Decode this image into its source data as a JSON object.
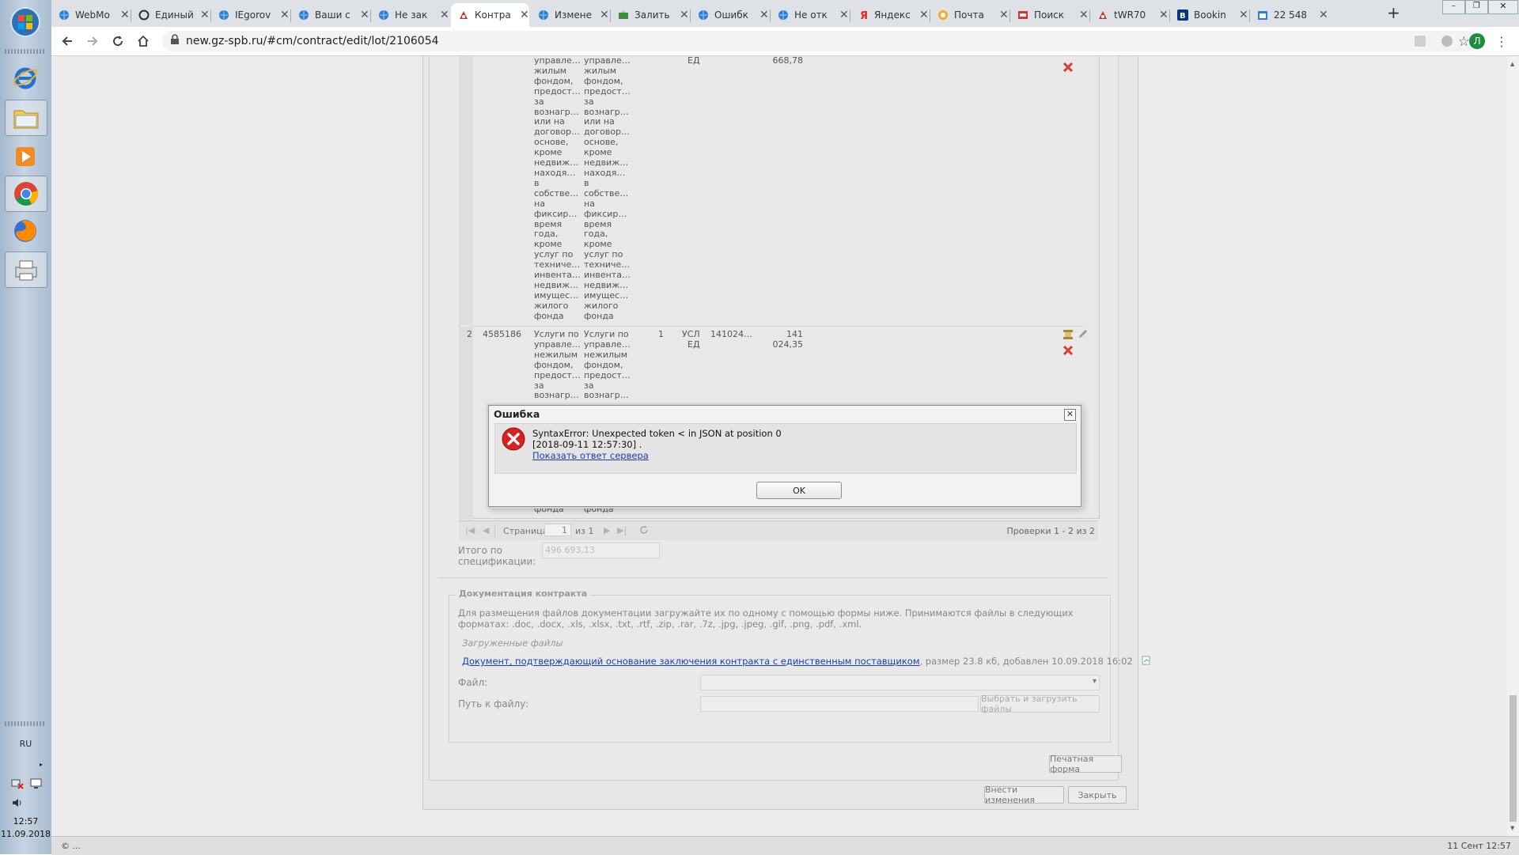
{
  "taskbar": {
    "lang": "RU",
    "time": "12:57",
    "date": "11.09.2018"
  },
  "browser": {
    "tabs": [
      {
        "label": "WebMo",
        "icon": "globe-icon",
        "active": false
      },
      {
        "label": "Единый",
        "icon": "circle-icon",
        "active": false
      },
      {
        "label": "IEgorov",
        "icon": "globe-icon",
        "active": false
      },
      {
        "label": "Ваши с",
        "icon": "globe-icon",
        "active": false
      },
      {
        "label": "Не зак",
        "icon": "globe-icon",
        "active": false
      },
      {
        "label": "Контра",
        "icon": "site-icon",
        "active": true
      },
      {
        "label": "Измене",
        "icon": "globe-icon",
        "active": false
      },
      {
        "label": "Залить",
        "icon": "upload-icon",
        "active": false
      },
      {
        "label": "Ошибк",
        "icon": "globe-icon",
        "active": false
      },
      {
        "label": "Не отк",
        "icon": "globe-icon",
        "active": false
      },
      {
        "label": "Яндекс",
        "icon": "yandex-icon",
        "active": false
      },
      {
        "label": "Почта",
        "icon": "mail-icon",
        "active": false
      },
      {
        "label": "Поиск",
        "icon": "search-site-icon",
        "active": false
      },
      {
        "label": "tWR70",
        "icon": "site-icon",
        "active": false
      },
      {
        "label": "Bookin",
        "icon": "booking-icon",
        "active": false
      },
      {
        "label": "22 548",
        "icon": "calendar-icon",
        "active": false
      }
    ],
    "url": "new.gz-spb.ru/#cm/contract/edit/lot/2106054",
    "profile_letter": "Л"
  },
  "grid": {
    "row1": {
      "unit": "ЕД",
      "price": "668,78",
      "name_lines": [
        "управле…",
        "жилым",
        "фондом,",
        "предост…",
        "за",
        "вознагр…",
        "или на",
        "договор…",
        "основе,",
        "кроме",
        "недвиж…",
        "находя…",
        "в",
        "собстве…",
        "на",
        "фиксир…",
        "время",
        "года,",
        "кроме",
        "услуг по",
        "техниче…",
        "инвента…",
        "недвиж…",
        "имущес…",
        "жилого",
        "фонда"
      ]
    },
    "row2": {
      "num": "2",
      "code": "4585186",
      "qty": "1",
      "unit_line1": "УСЛ",
      "unit_line2": "ЕД",
      "okpd": "141024…",
      "price_line1": "141",
      "price_line2": "024,35",
      "name_lines": [
        "Услуги по",
        "управле…",
        "нежилым",
        "фондом,",
        "предост…",
        "за",
        "вознагр…"
      ],
      "tail": "фонда"
    }
  },
  "pager": {
    "page_label": "Страница",
    "page_value": "1",
    "of_label": "из 1",
    "summary": "Проверки 1 - 2 из 2"
  },
  "totals": {
    "label_line1": "Итого по",
    "label_line2": "спецификации:",
    "value": "496 693,13"
  },
  "docs": {
    "legend": "Документация контракта",
    "info": "Для размещения файлов документации загружайте их по одному с помощью формы ниже. Принимаются файлы в следующих форматах: .doc, .docx, .xls, .xlsx, .txt, .rtf, .zip, .rar, .7z, .jpg, .jpeg, .gif, .png, .pdf, .xml.",
    "uploaded_label": "Загруженные файлы",
    "file_link": "Документ, подтверждающий основание заключения контракта с единственным поставщиком",
    "file_meta": ", размер 23.8 кб, добавлен 10.09.2018 16:02",
    "file_label": "Файл:",
    "path_label": "Путь к файлу:",
    "upload_button": "Выбрать и загрузить файлы"
  },
  "buttons": {
    "print": "Печатная форма",
    "apply": "Внести изменения",
    "close": "Закрыть"
  },
  "statusbar": {
    "left": "© ...",
    "right": "11 Сент 12:57"
  },
  "dialog": {
    "title": "Ошибка",
    "message": "SyntaxError: Unexpected token < in JSON at position 0",
    "timestamp": "[2018-09-11 12:57:30] .",
    "link": "Показать ответ сервера",
    "ok": "OK"
  },
  "colors": {
    "link": "#1a3fb5",
    "error_red": "#d9221e",
    "active_profile": "#1e8e3e"
  }
}
